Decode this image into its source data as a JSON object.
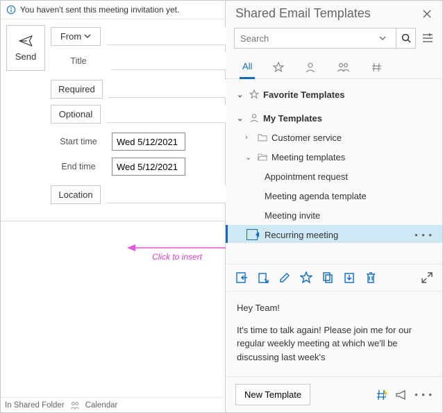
{
  "info_bar": "You haven't sent this meeting invitation yet.",
  "send_label": "Send",
  "fields": {
    "from": "From",
    "title": "Title",
    "required": "Required",
    "optional": "Optional",
    "start_time": "Start time",
    "end_time": "End time",
    "location": "Location",
    "start_value": "Wed 5/12/2021",
    "end_value": "Wed 5/12/2021"
  },
  "click_insert": "Click to insert",
  "status": {
    "folder": "In Shared Folder",
    "calendar": "Calendar"
  },
  "panel": {
    "title": "Shared Email Templates",
    "search_placeholder": "Search",
    "tabs": {
      "all": "All"
    },
    "tree": {
      "favorites": "Favorite Templates",
      "mytemplates": "My Templates",
      "customer": "Customer service",
      "meetingfolder": "Meeting templates",
      "items": {
        "appt": "Appointment request",
        "agenda": "Meeting agenda template",
        "invite": "Meeting invite",
        "recurring": "Recurring meeting"
      }
    },
    "preview": {
      "p1": "Hey Team!",
      "p2": "It's time to talk again! Please join me for our regular weekly meeting at which we'll be discussing last week's"
    },
    "new_template": "New Template"
  }
}
